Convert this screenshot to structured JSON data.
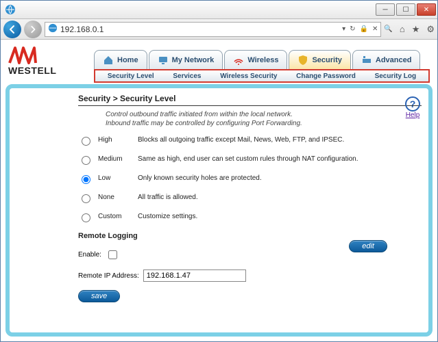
{
  "window": {
    "url": "192.168.0.1"
  },
  "logo": {
    "brand": "WESTELL"
  },
  "tabs": {
    "home": "Home",
    "my_network": "My Network",
    "wireless": "Wireless",
    "security": "Security",
    "advanced": "Advanced",
    "active": "security"
  },
  "subtabs": {
    "security_level": "Security Level",
    "services": "Services",
    "wireless_security": "Wireless Security",
    "change_password": "Change Password",
    "security_log": "Security Log"
  },
  "breadcrumb": "Security > Security Level",
  "description_line1": "Control outbound traffic initiated from within the local network.",
  "description_line2": "Inbound traffic may be controlled by configuring Port Forwarding.",
  "help": {
    "label": "Help"
  },
  "options": {
    "high": {
      "label": "High",
      "desc": "Blocks all outgoing traffic except Mail, News, Web, FTP, and IPSEC."
    },
    "medium": {
      "label": "Medium",
      "desc": "Same as high, end user can set custom rules through NAT configuration."
    },
    "low": {
      "label": "Low",
      "desc": "Only known security holes are protected."
    },
    "none": {
      "label": "None",
      "desc": "All traffic is allowed."
    },
    "custom": {
      "label": "Custom",
      "desc": "Customize settings."
    },
    "selected": "low"
  },
  "buttons": {
    "edit": "edit",
    "save": "save"
  },
  "remote": {
    "heading": "Remote Logging",
    "enable_label": "Enable:",
    "enable_checked": false,
    "ip_label": "Remote IP Address:",
    "ip_value": "192.168.1.47"
  }
}
